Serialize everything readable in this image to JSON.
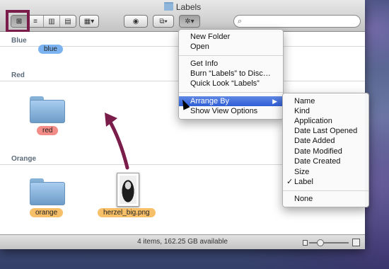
{
  "window": {
    "title": "Labels"
  },
  "toolbar": {
    "view_buttons": [
      {
        "name": "icon-view-button",
        "glyph": "⊞",
        "active": true
      },
      {
        "name": "list-view-button",
        "glyph": "≡",
        "active": false
      },
      {
        "name": "column-view-button",
        "glyph": "▥",
        "active": false
      },
      {
        "name": "coverflow-view-button",
        "glyph": "▤",
        "active": false
      }
    ],
    "arrange_glyph": "▦▾",
    "quicklook_glyph": "◉",
    "share_glyph": "⧉▾",
    "action_glyph": "✲▾",
    "search_placeholder": ""
  },
  "groups": {
    "blue": {
      "header": "Blue",
      "item_label": "blue"
    },
    "red": {
      "header": "Red",
      "item_label": "red"
    },
    "orange": {
      "header": "Orange",
      "item_labels": [
        "orange",
        "herzel_big.png"
      ]
    }
  },
  "colors": {
    "blue_label": "#7bb3f0",
    "red_label": "#f38b86",
    "orange_label": "#f7bf68",
    "highlight": "#7a1d4a",
    "menu_highlight": "#3a67d9"
  },
  "status": {
    "text": "4 items, 162.25 GB available"
  },
  "action_menu": {
    "items_group1": [
      "New Folder",
      "Open"
    ],
    "items_group2": [
      "Get Info",
      "Burn “Labels” to Disc…",
      "Quick Look “Labels”"
    ],
    "arrange_by": "Arrange By",
    "show_view_options": "Show View Options"
  },
  "arrange_submenu": {
    "items": [
      "Name",
      "Kind",
      "Application",
      "Date Last Opened",
      "Date Added",
      "Date Modified",
      "Date Created",
      "Size",
      "Label"
    ],
    "checked": "Label",
    "none": "None",
    "check_glyph": "✓"
  },
  "icons": {
    "folder": "folder-icon",
    "search": "magnifier-icon",
    "arrow": "annotation-arrow"
  }
}
